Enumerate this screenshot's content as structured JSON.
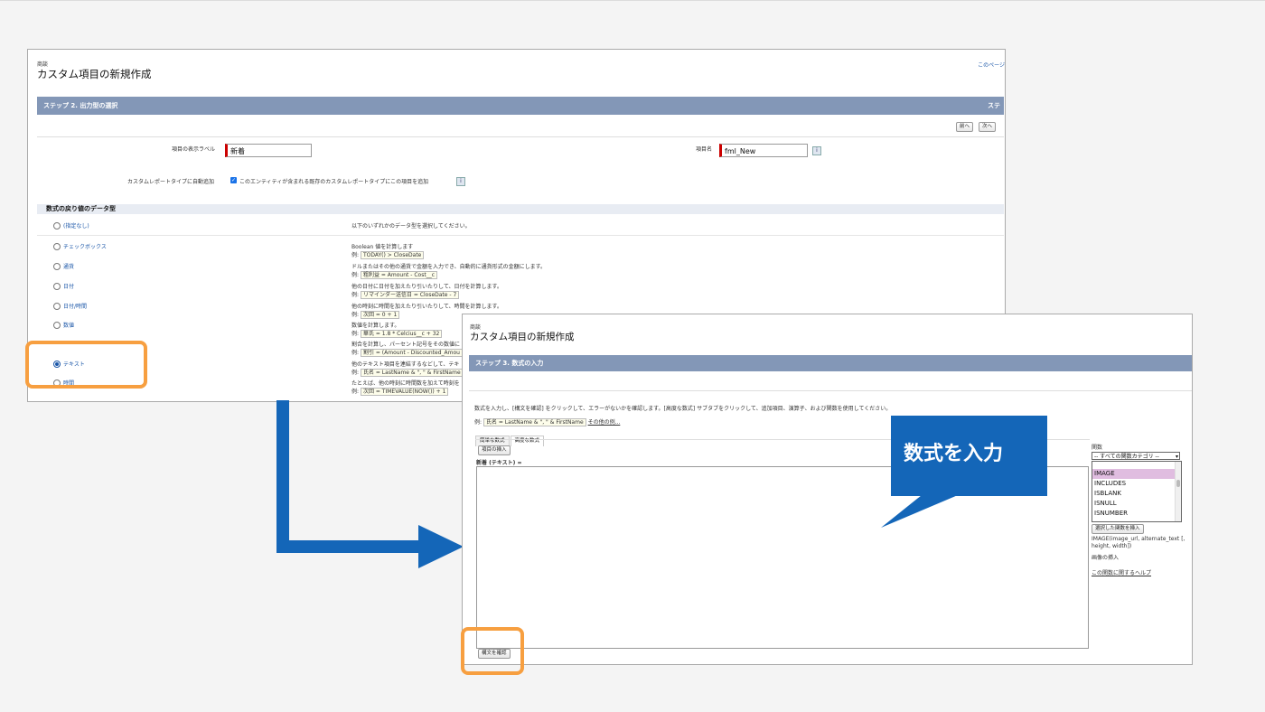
{
  "win1": {
    "breadcrumb": "商談",
    "title": "カスタム項目の新規作成",
    "help_link": "このページ",
    "step_bar": "ステップ 2. 出力型の選択",
    "step_bar_right": "ステ",
    "prev_button": "前へ",
    "next_button": "次へ",
    "label_field_label": "項目の表示ラベル",
    "label_field_value": "新着",
    "name_field_label": "項目名",
    "name_field_value": "fml_New",
    "auto_add_label": "カスタムレポートタイプに自動追加",
    "auto_add_text": "このエンティティが含まれる既存のカスタムレポートタイプにこの項目を追加",
    "section_title": "数式の戻り値のデータ型",
    "types": [
      {
        "label": "(指定なし)",
        "desc": "以下のいずれかのデータ型を選択してください。",
        "example": ""
      },
      {
        "label": "チェックボックス",
        "desc": "Boolean 値を計算します",
        "example": "TODAY() > CloseDate"
      },
      {
        "label": "通貨",
        "desc": "ドルまたはその他の通貨で金額を入力でき、自動的に通貨形式の金額にします。",
        "example": "粗利益 = Amount - Cost__c"
      },
      {
        "label": "日付",
        "desc": "他の日付に日付を加えたり引いたりして、日付を計算します。",
        "example": "リマインダー送信日 = CloseDate - 7"
      },
      {
        "label": "日付/時間",
        "desc": "他の時刻に時間を加えたり引いたりして、時間を計算します。",
        "example": "次回 = 0 + 1"
      },
      {
        "label": "数値",
        "desc": "数値を計算します。",
        "example": "華氏 = 1.8 * Celcius__c + 32"
      },
      {
        "label": "",
        "desc": "割合を計算し、パーセント記号をその数値に",
        "example": "割引 = (Amount - Discounted_Amou"
      },
      {
        "label": "テキスト",
        "desc": "他のテキスト項目を連結するなどして、テキ",
        "example": "氏名 = LastName & \", \" & FirstName"
      },
      {
        "label": "時間",
        "desc": "たとえば、他の時刻に時間数を加えて時刻を",
        "example": "次回 = TIMEVALUE(NOW()) + 1"
      }
    ],
    "example_prefix": "例:"
  },
  "win2": {
    "breadcrumb": "商談",
    "title": "カスタム項目の新規作成",
    "step_bar": "ステップ 3. 数式の入力",
    "instructions": "数式を入力し、[構文を確認] をクリックして、エラーがないかを確認します。[高度な数式] サブタブをクリックして、追加項目、演算子、および関数を使用してください。",
    "example_prefix": "例:",
    "example_code": "氏名 = LastName & \", \" & FirstName",
    "example_more": "その他の例...",
    "tab_simple": "簡単な数式",
    "tab_advanced": "高度な数式",
    "insert_field_button": "項目の挿入",
    "formula_label": "新着 (テキスト) =",
    "check_syntax_button": "構文を確認",
    "functions_label": "関数",
    "functions_category": "-- すべての関数カテゴリ --",
    "functions": [
      "IMAGE",
      "INCLUDES",
      "ISBLANK",
      "ISNULL",
      "ISNUMBER"
    ],
    "selected_function": "IMAGE",
    "insert_function_button": "選択した関数を挿入",
    "function_signature": "IMAGE(image_url, alternate_text [, height, width])",
    "function_desc": "画像の挿入",
    "function_help": "この関数に関するヘルプ"
  },
  "callout": {
    "text": "数式を入力"
  },
  "colors": {
    "accent": "#1466b8",
    "highlight": "#f79f40",
    "step_bar": "#8397b7"
  }
}
